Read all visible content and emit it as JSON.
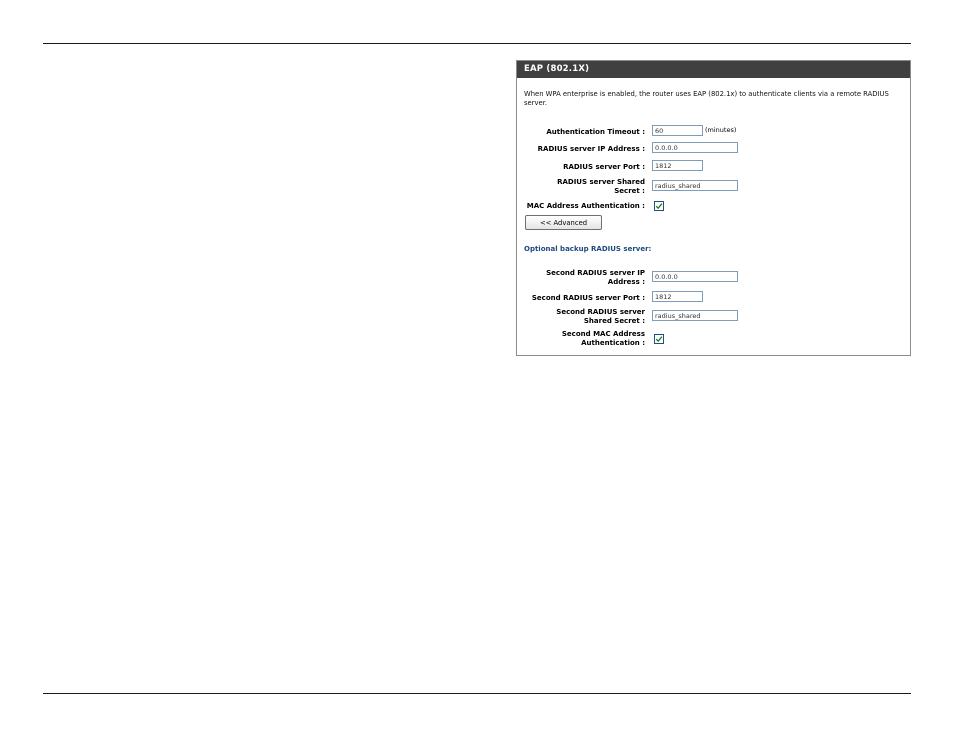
{
  "panel": {
    "title": "EAP (802.1X)",
    "description": "When WPA enterprise is enabled, the router uses EAP (802.1x) to authenticate clients via a remote RADIUS server."
  },
  "primary": {
    "auth_timeout": {
      "label": "Authentication Timeout :",
      "value": "60",
      "unit": "(minutes)"
    },
    "server_ip": {
      "label": "RADIUS server IP Address :",
      "value": "0.0.0.0"
    },
    "server_port": {
      "label": "RADIUS server Port :",
      "value": "1812"
    },
    "shared_secret": {
      "label_line1": "RADIUS server Shared",
      "label_line2": "Secret :",
      "value": "radius_shared"
    },
    "mac_auth": {
      "label": "MAC Address Authentication :",
      "checked": true
    }
  },
  "advanced_button": "<< Advanced",
  "backup": {
    "section_title": "Optional backup RADIUS server:",
    "server_ip": {
      "label_line1": "Second RADIUS server IP",
      "label_line2": "Address :",
      "value": "0.0.0.0"
    },
    "server_port": {
      "label": "Second RADIUS server Port :",
      "value": "1812"
    },
    "shared_secret": {
      "label_line1": "Second RADIUS server",
      "label_line2": "Shared Secret :",
      "value": "radius_shared"
    },
    "mac_auth": {
      "label_line1": "Second MAC Address",
      "label_line2": "Authentication :",
      "checked": true
    }
  },
  "colors": {
    "header_bg": "#404040",
    "section_title": "#1e4a80",
    "checkmark": "#1f7a1f"
  }
}
